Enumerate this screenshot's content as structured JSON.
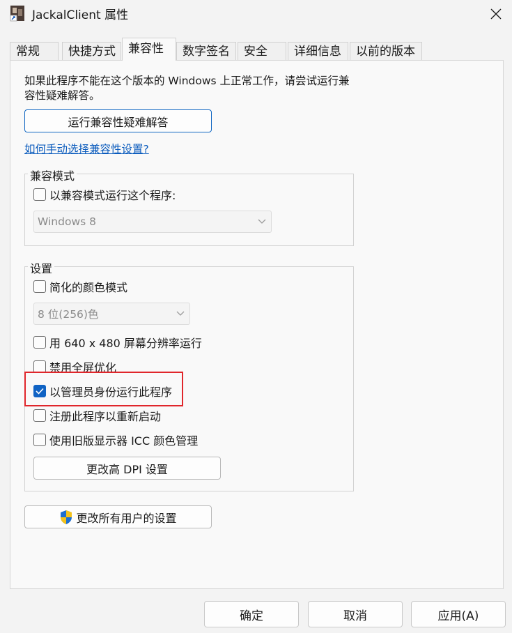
{
  "window": {
    "title": "JackalClient 属性"
  },
  "tabs": [
    {
      "label": "常规"
    },
    {
      "label": "快捷方式"
    },
    {
      "label": "兼容性"
    },
    {
      "label": "数字签名"
    },
    {
      "label": "安全"
    },
    {
      "label": "详细信息"
    },
    {
      "label": "以前的版本"
    }
  ],
  "compat": {
    "description": "如果此程序不能在这个版本的 Windows 上正常工作，请尝试运行兼容性疑难解答。",
    "troubleshoot_button": "运行兼容性疑难解答",
    "manual_link": "如何手动选择兼容性设置?",
    "mode_group_title": "兼容模式",
    "mode_checkbox": "以兼容模式运行这个程序:",
    "mode_select_value": "Windows 8",
    "settings_group_title": "设置",
    "reduced_color": "简化的颜色模式",
    "color_select_value": "8 位(256)色",
    "res_640": "用 640 x 480 屏幕分辨率运行",
    "disable_fullscreen_opt": "禁用全屏优化",
    "run_as_admin": "以管理员身份运行此程序",
    "register_restart": "注册此程序以重新启动",
    "legacy_icc": "使用旧版显示器 ICC 颜色管理",
    "dpi_button": "更改高 DPI 设置",
    "all_users_button": "更改所有用户的设置"
  },
  "checked": {
    "run_as_admin": true
  },
  "footer": {
    "ok": "确定",
    "cancel": "取消",
    "apply": "应用(A)"
  },
  "colors": {
    "accent": "#1063c4",
    "highlight": "#e0262b",
    "link": "#0a5bbd"
  }
}
